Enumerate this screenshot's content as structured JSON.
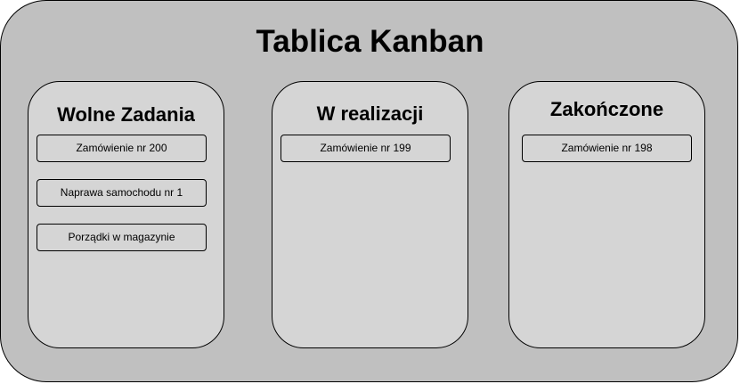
{
  "board": {
    "title": "Tablica Kanban"
  },
  "columns": [
    {
      "title": "Wolne Zadania",
      "cards": [
        "Zamówienie nr 200",
        "Naprawa samochodu nr 1",
        "Porządki w magazynie"
      ]
    },
    {
      "title": "W realizacji",
      "cards": [
        "Zamówienie nr 199"
      ]
    },
    {
      "title": "Zakończone",
      "cards": [
        "Zamówienie nr 198"
      ]
    }
  ],
  "colors": {
    "board_background": "#c0c0c0",
    "column_background": "#d5d5d5",
    "border": "#000000"
  }
}
